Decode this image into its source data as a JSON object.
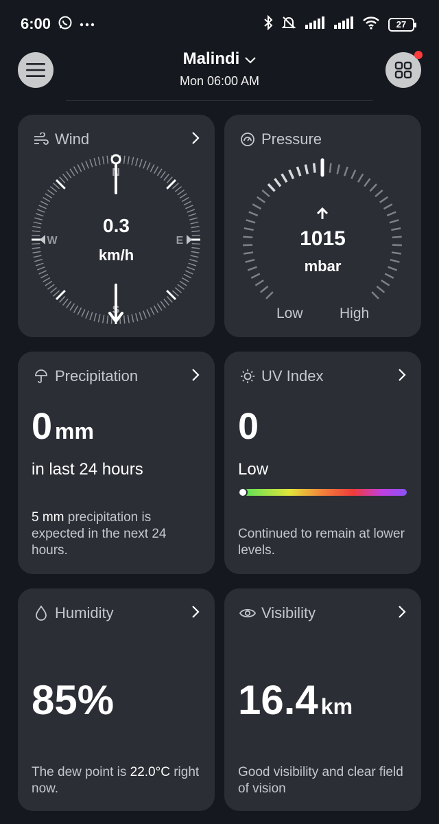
{
  "status": {
    "time": "6:00",
    "battery": "27"
  },
  "header": {
    "location": "Malindi",
    "datetime": "Mon 06:00 AM"
  },
  "wind": {
    "title": "Wind",
    "speed": "0.3",
    "unit": "km/h",
    "compass": {
      "n": "N",
      "s": "S",
      "e": "E",
      "w": "W"
    }
  },
  "pressure": {
    "title": "Pressure",
    "value": "1015",
    "unit": "mbar",
    "low_label": "Low",
    "high_label": "High",
    "level": 0.5
  },
  "precipitation": {
    "title": "Precipitation",
    "value": "0",
    "unit": "mm",
    "period": "in last 24 hours",
    "forecast_amount": "5 mm",
    "forecast_text": " precipitation is expected in the next 24 hours."
  },
  "uv": {
    "title": "UV Index",
    "value": "0",
    "level": "Low",
    "bar_position": 0.0,
    "description": "Continued to remain at lower levels."
  },
  "humidity": {
    "title": "Humidity",
    "value": "85%",
    "desc_pre": "The dew point is ",
    "dew_point": "22.0°C",
    "desc_post": " right now."
  },
  "visibility": {
    "title": "Visibility",
    "value": "16.4",
    "unit": "km",
    "description": "Good visibility and clear field of vision"
  },
  "colors": {
    "background": "#15181e",
    "card": "#2b2e35",
    "muted_text": "#c4c7cc",
    "notification": "#ff3b3b"
  }
}
